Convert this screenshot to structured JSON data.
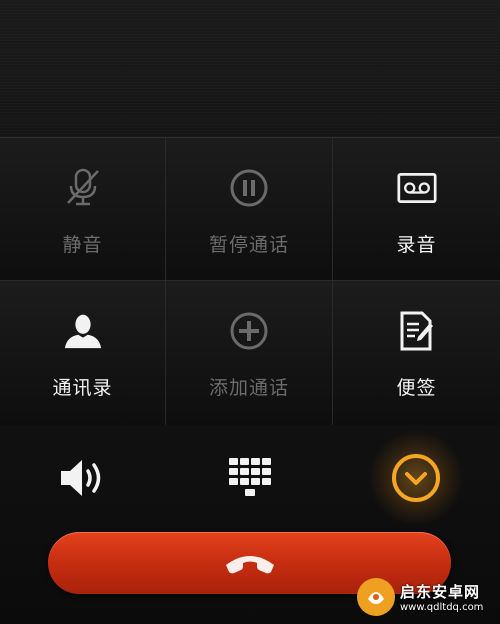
{
  "grid": {
    "items": [
      {
        "label": "静音",
        "icon": "mic-off-icon",
        "enabled": false
      },
      {
        "label": "暂停通话",
        "icon": "pause-icon",
        "enabled": false
      },
      {
        "label": "录音",
        "icon": "tape-icon",
        "enabled": true
      },
      {
        "label": "通讯录",
        "icon": "contact-icon",
        "enabled": true
      },
      {
        "label": "添加通话",
        "icon": "add-call-icon",
        "enabled": false
      },
      {
        "label": "便签",
        "icon": "note-icon",
        "enabled": true
      }
    ]
  },
  "controls": {
    "speaker": "speaker-icon",
    "dialpad": "dialpad-icon",
    "collapse": "chevron-down-icon",
    "accent_color": "#f5a623"
  },
  "end_call": {
    "icon": "phone-hangup-icon",
    "color": "#d0321a"
  },
  "watermark": {
    "name": "启东安卓网",
    "url": "www.qdltdq.com"
  }
}
